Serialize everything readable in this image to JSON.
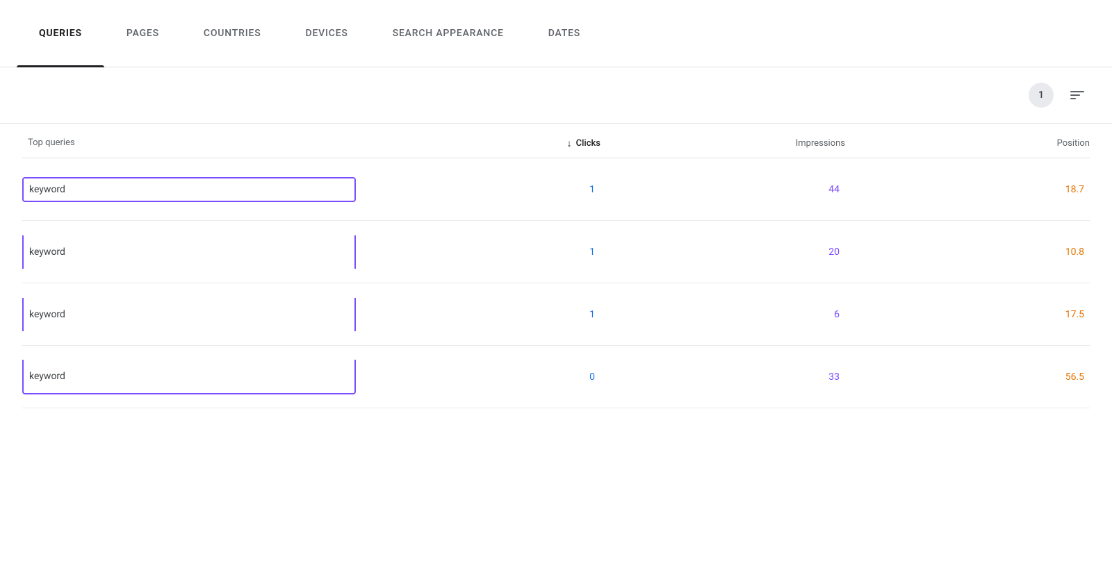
{
  "tabs": [
    {
      "id": "queries",
      "label": "QUERIES",
      "active": true
    },
    {
      "id": "pages",
      "label": "PAGES",
      "active": false
    },
    {
      "id": "countries",
      "label": "COUNTRIES",
      "active": false
    },
    {
      "id": "devices",
      "label": "DEVICES",
      "active": false
    },
    {
      "id": "search-appearance",
      "label": "SEARCH APPEARANCE",
      "active": false
    },
    {
      "id": "dates",
      "label": "DATES",
      "active": false
    }
  ],
  "toolbar": {
    "filter_count": "1",
    "filter_icon_label": "filter"
  },
  "table": {
    "headers": {
      "query": "Top queries",
      "clicks": "Clicks",
      "impressions": "Impressions",
      "position": "Position"
    },
    "rows": [
      {
        "query": "keyword",
        "clicks": "1",
        "impressions": "44",
        "position": "18.7",
        "selected": true
      },
      {
        "query": "keyword",
        "clicks": "1",
        "impressions": "20",
        "position": "10.8",
        "selected": true
      },
      {
        "query": "keyword",
        "clicks": "1",
        "impressions": "6",
        "position": "17.5",
        "selected": true
      },
      {
        "query": "keyword",
        "clicks": "0",
        "impressions": "33",
        "position": "56.5",
        "selected": true
      }
    ]
  }
}
